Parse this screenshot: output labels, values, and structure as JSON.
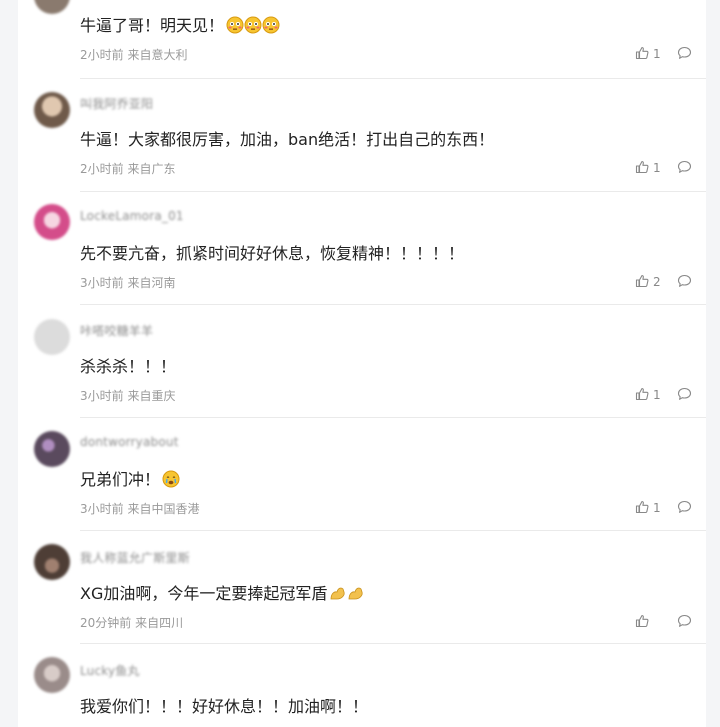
{
  "comments": [
    {
      "text": "牛逼了哥！明天见！",
      "emoji": "flushed-face-x3",
      "time": "2小时前",
      "source": "来自意大利",
      "likes": "1",
      "avatar_color": "#8a7a6e"
    },
    {
      "username": "叫我阿乔亚阳",
      "text": "牛逼！大家都很厉害，加油，ban绝活！打出自己的东西！",
      "time": "2小时前",
      "source": "来自广东",
      "likes": "1",
      "avatar_color": "#6f5a4a"
    },
    {
      "username": "LockeLamora_01",
      "text": "先不要亢奋，抓紧时间好好休息，恢复精神！！！！！",
      "time": "3小时前",
      "source": "来自河南",
      "likes": "2",
      "avatar_color": "#d44d8a"
    },
    {
      "username": "咔嗒咬糖羊羊",
      "text": "杀杀杀！！！",
      "time": "3小时前",
      "source": "来自重庆",
      "likes": "1",
      "avatar_color": "#d9d9d9"
    },
    {
      "username": "dontworryabout",
      "text": "兄弟们冲！",
      "emoji": "crying-face",
      "time": "3小时前",
      "source": "来自中国香港",
      "likes": "1",
      "avatar_color": "#5a4a5e"
    },
    {
      "username": "我人称蓝允广斯里斯",
      "text": "XG加油啊，今年一定要捧起冠军盾",
      "emoji": "flexed-biceps-x2",
      "time": "20分钟前",
      "source": "来自四川",
      "likes": "",
      "avatar_color": "#4e3e36"
    },
    {
      "username": "Lucky鱼丸",
      "text": "我爱你们！！！好好休息！！加油啊！！",
      "avatar_color": "#9a8c8a"
    }
  ]
}
